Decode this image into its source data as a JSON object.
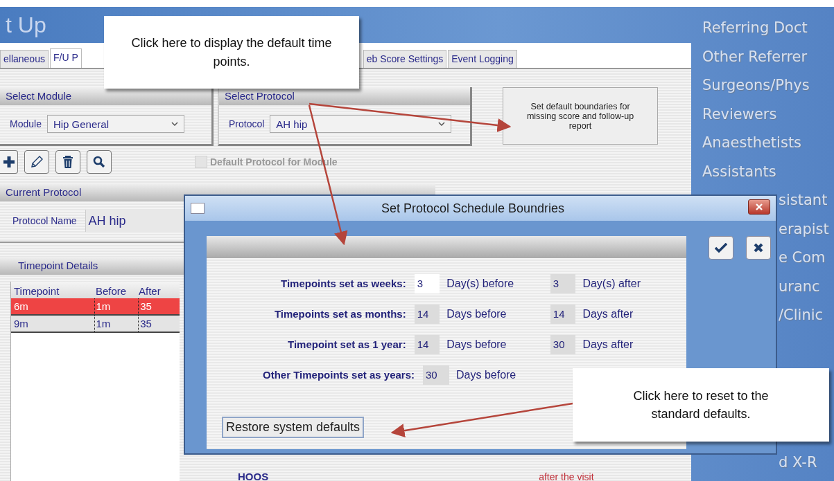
{
  "app_title": "t Up",
  "tabs": [
    {
      "label": "ellaneous",
      "selected": false
    },
    {
      "label": "F/U P",
      "selected": true
    },
    {
      "label": "eb Score Settings",
      "selected": false
    },
    {
      "label": "Event Logging",
      "selected": false
    }
  ],
  "sidebar": {
    "items": [
      {
        "label": "Referring Doct",
        "partial": false
      },
      {
        "label": "Other Referrer",
        "partial": false
      },
      {
        "label": "Surgeons/Phys",
        "partial": false
      },
      {
        "label": "Reviewers",
        "partial": false
      },
      {
        "label": "Anaesthetists",
        "partial": false
      },
      {
        "label": "Assistants",
        "partial": false
      },
      {
        "label": "sistant",
        "partial": true
      },
      {
        "label": "erapist",
        "partial": true
      },
      {
        "label": "e Com",
        "partial": true
      },
      {
        "label": "uranc",
        "partial": true
      },
      {
        "label": "/Clinic",
        "partial": true
      },
      {
        "label": "d X-R",
        "partial": true
      }
    ]
  },
  "module_group": {
    "title": "Select Module",
    "label": "Module",
    "value": "Hip General"
  },
  "protocol_group": {
    "title": "Select Protocol",
    "label": "Protocol",
    "value": "AH hip"
  },
  "boundaries_button": "Set default boundaries for missing score and follow-up report",
  "default_checkbox": {
    "label": "Default Protocol for Module",
    "checked": false,
    "disabled": true
  },
  "current_protocol": {
    "title": "Current Protocol",
    "label": "Protocol Name",
    "value": "AH hip"
  },
  "timepoints": {
    "title": "Timepoint Details",
    "columns": [
      "Timepoint",
      "Before",
      "After"
    ],
    "rows": [
      {
        "cells": [
          "6m",
          "1m",
          "35"
        ],
        "selected": true
      },
      {
        "cells": [
          "9m",
          "1m",
          "35"
        ],
        "selected": false
      }
    ]
  },
  "behind_dialog": {
    "item": "HOOS",
    "note": "after the visit"
  },
  "dialog": {
    "title": "Set Protocol Schedule Boundries",
    "rows": [
      {
        "label": "Timepoints set as weeks:",
        "before": {
          "value": "3",
          "editable": true
        },
        "before_unit": "Day(s) before",
        "after": {
          "value": "3",
          "editable": false
        },
        "after_unit": "Day(s) after"
      },
      {
        "label": "Timepoints set as months:",
        "before": {
          "value": "14",
          "editable": false
        },
        "before_unit": "Days before",
        "after": {
          "value": "14",
          "editable": false
        },
        "after_unit": "Days after"
      },
      {
        "label": "Timepoint set as 1 year:",
        "before": {
          "value": "14",
          "editable": false
        },
        "before_unit": "Days before",
        "after": {
          "value": "30",
          "editable": false
        },
        "after_unit": "Days after"
      },
      {
        "label": "Other Timepoints set as years:",
        "before": {
          "value": "30",
          "editable": false
        },
        "before_unit": "Days before"
      }
    ],
    "restore_button": "Restore system defaults"
  },
  "callouts": [
    "Click here to display the default time points.",
    "Click here to reset to the standard defaults."
  ]
}
